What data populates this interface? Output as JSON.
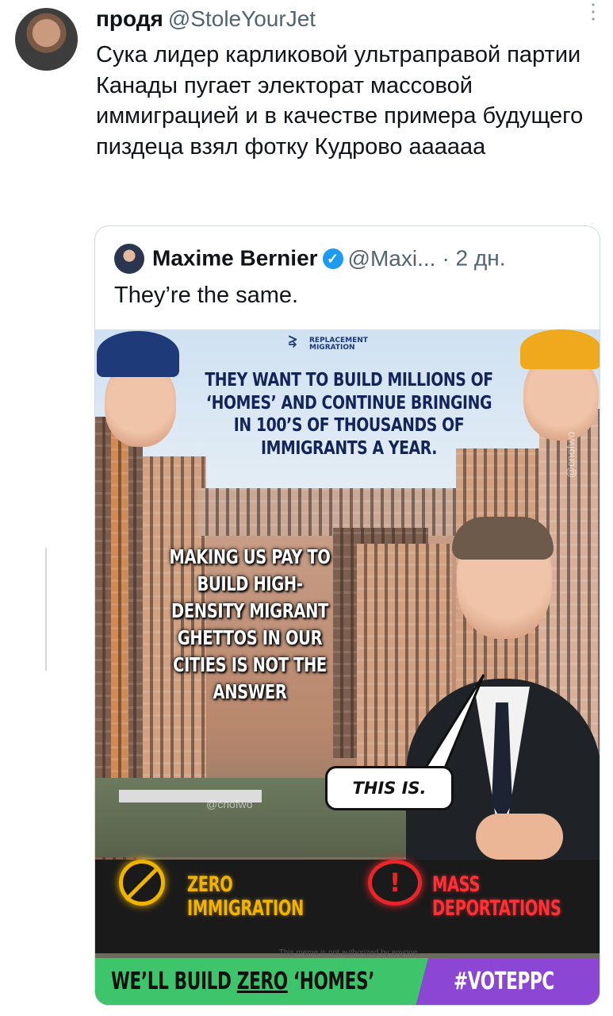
{
  "tweet": {
    "display_name": "продя",
    "handle": "@StoleYourJet",
    "more_icon": "more-vertical-icon",
    "text": "Сука лидер карликовой ультраправой партии Канады пугает электорат массовой иммиграцией и в качестве примера будущего пиздеца взял фотку Кудрово аааааа"
  },
  "quote": {
    "display_name": "Maxime Bernier",
    "verified_icon": "verified-badge-icon",
    "handle": "@Maxi...",
    "separator": "·",
    "time": "2 дн.",
    "text": "They’re the same."
  },
  "meme": {
    "logo_line1": "REPLACEMENT",
    "logo_line2": "MIGRATION",
    "headline": "THEY WANT TO BUILD MILLIONS OF ‘HOMES’ AND CONTINUE BRINGING IN 100’S OF THOUSANDS OF IMMIGRANTS A YEAR.",
    "left_text": "MAKING US PAY TO BUILD HIGH-DENSITY MIGRANT GHETTOS IN OUR CITIES IS NOT THE ANSWER",
    "bubble": "THIS IS.",
    "watermark_1": "@cnofwo",
    "watermark_2": "@cnofwo",
    "zero_line1": "ZERO",
    "zero_line2": "IMMIGRATION",
    "mass_line1": "MASS",
    "mass_line2": "DEPORTATIONS",
    "disclaimer": "This meme is not authorized by anyone",
    "footer_pre": "WE’LL BUILD ",
    "footer_zero": "ZERO",
    "footer_post": " ‘HOMES’",
    "hashtag": "#VOTEPPC",
    "colors": {
      "yellow": "#f0b400",
      "red": "#e8262a",
      "green": "#3ec56c",
      "purple": "#8b46d4"
    }
  }
}
